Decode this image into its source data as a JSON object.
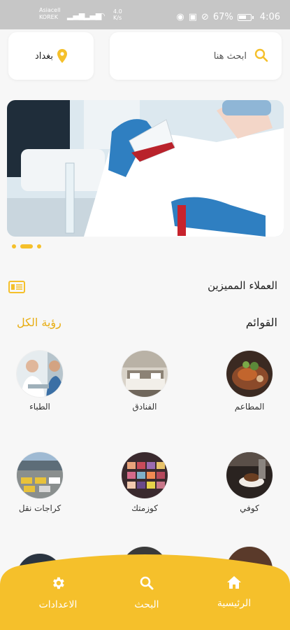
{
  "status_bar": {
    "carrier_line1": "Asiacell",
    "carrier_line2": "KOREK",
    "speed_value": "4.0",
    "speed_unit": "K/s",
    "battery": "67%",
    "time": "4:06"
  },
  "location": {
    "city": "بغداد",
    "icon": "location-pin-icon"
  },
  "search": {
    "placeholder": "ابحث هنا",
    "icon": "search-icon"
  },
  "banner": {
    "image": "lab-scientist-photo",
    "slides": 3,
    "active_slide": 2
  },
  "featured": {
    "title": "العملاء المميزين",
    "icon": "card-icon"
  },
  "lists": {
    "title": "القوائم",
    "see_all": "رؤية الكل",
    "categories": [
      {
        "label": "المطاعم",
        "image": "restaurant-food-photo"
      },
      {
        "label": "الفنادق",
        "image": "hotel-room-photo"
      },
      {
        "label": "الطباء",
        "image": "doctor-photo"
      },
      {
        "label": "كوفي",
        "image": "coffee-photo"
      },
      {
        "label": "كوزمتك",
        "image": "cosmetics-palette-photo"
      },
      {
        "label": "كراجات نقل",
        "image": "transport-garage-photo"
      }
    ]
  },
  "bottom_nav": {
    "items": [
      {
        "label": "الرئيسية",
        "icon": "home-icon"
      },
      {
        "label": "البحث",
        "icon": "search-icon"
      },
      {
        "label": "الاعدادات",
        "icon": "gear-icon"
      }
    ],
    "color": "#f5c02b"
  },
  "colors": {
    "accent": "#f5c02b",
    "see_all": "#e8ad12",
    "background": "#f7f7f7",
    "status_bar": "#c6c6c6"
  }
}
